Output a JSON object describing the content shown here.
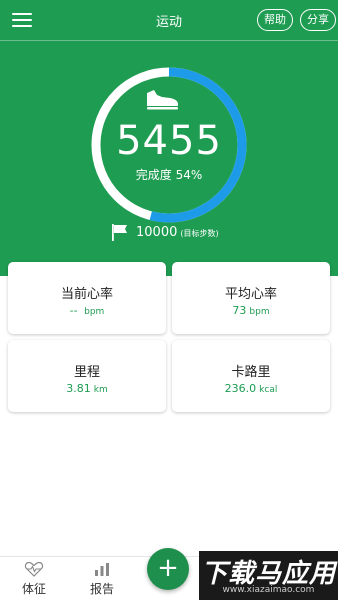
{
  "header": {
    "title": "运动",
    "help_label": "帮助",
    "share_label": "分享"
  },
  "summary": {
    "steps": "5455",
    "progress_text": "完成度 54%",
    "progress_fraction": 0.54,
    "goal_value": "10000",
    "goal_note": "(目标步数)"
  },
  "cards": {
    "current_hr": {
      "label": "当前心率",
      "value": "-- ",
      "unit": "bpm"
    },
    "avg_hr": {
      "label": "平均心率",
      "value": "73",
      "unit": "bpm"
    },
    "distance": {
      "label": "里程",
      "value": "3.81",
      "unit": "km"
    },
    "calories": {
      "label": "卡路里",
      "value": "236.0",
      "unit": "kcal"
    }
  },
  "bottom_nav": {
    "health_label": "体征",
    "report_label": "报告",
    "add_symbol": "+"
  },
  "watermark": {
    "text": "下载马应用",
    "url": "www.xiazaimao.com"
  },
  "colors": {
    "primary": "#1e9c52",
    "ring_track": "#ffffff",
    "ring_progress": "#1e9be8"
  },
  "icons": {
    "menu": "menu-icon",
    "shoe": "shoe-icon",
    "flag": "flag-icon",
    "heart": "heart-pulse-icon",
    "chart": "bar-chart-icon"
  }
}
